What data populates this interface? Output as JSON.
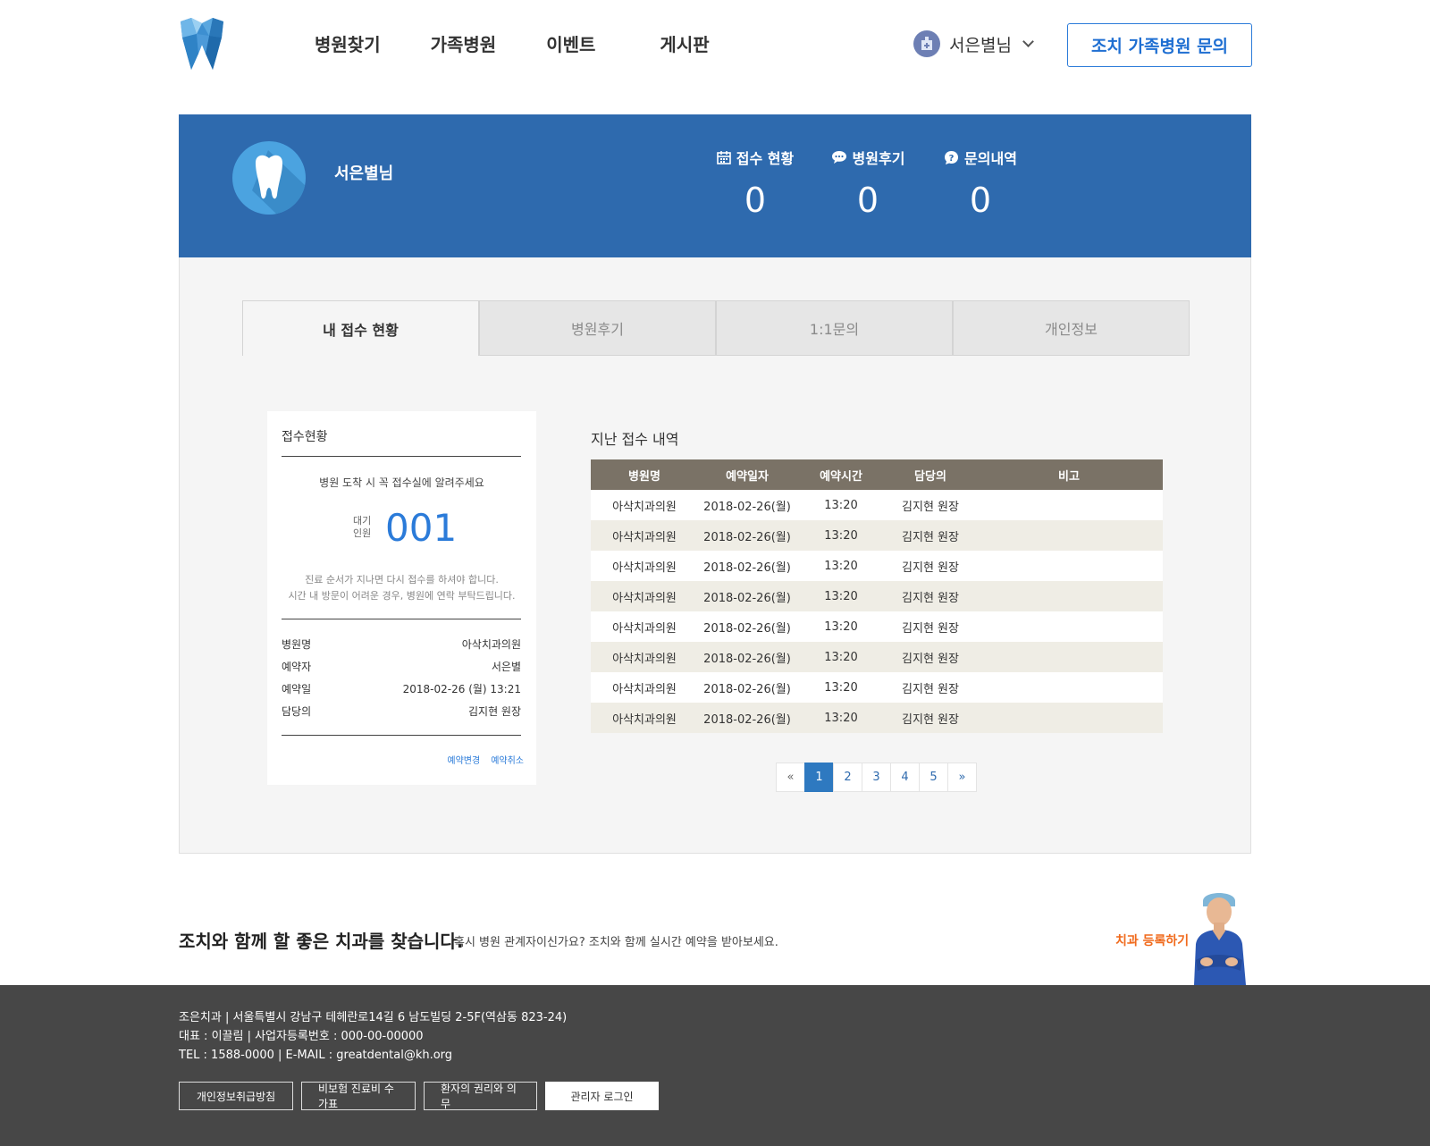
{
  "header": {
    "nav": [
      "병원찾기",
      "가족병원",
      "이벤트",
      "게시판"
    ],
    "user_name": "서은별님",
    "inquiry_button": "조치 가족병원 문의"
  },
  "profile": {
    "name": "서은별님",
    "stats": [
      {
        "icon": "calendar-icon",
        "label": "접수 현황",
        "value": "0"
      },
      {
        "icon": "chat-icon",
        "label": "병원후기",
        "value": "0"
      },
      {
        "icon": "question-icon",
        "label": "문의내역",
        "value": "0"
      }
    ]
  },
  "tabs": [
    "내 접수 현황",
    "병원후기",
    "1:1문의",
    "개인정보"
  ],
  "reception_card": {
    "title": "접수현황",
    "notice": "병원 도착 시 꼭 접수실에 알려주세요",
    "wait_label_1": "대기",
    "wait_label_2": "인원",
    "wait_number": "001",
    "note_1": "진료 순서가 지나면 다시 접수를 하셔야 합니다.",
    "note_2": "시간 내 방문이 어려운 경우, 병원에 연락 부탁드립니다.",
    "rows": [
      {
        "label": "병원명",
        "value": "아삭치과의원"
      },
      {
        "label": "예약자",
        "value": "서은별"
      },
      {
        "label": "예약일",
        "value": "2018-02-26 (월) 13:21"
      },
      {
        "label": "담당의",
        "value": "김지현 원장"
      }
    ],
    "change_link": "예약변경",
    "cancel_link": "예약취소"
  },
  "history": {
    "title": "지난 접수 내역",
    "columns": [
      "병원명",
      "예약일자",
      "예약시간",
      "담당의",
      "비고"
    ],
    "rows": [
      [
        "아삭치과의원",
        "2018-02-26(월)",
        "13:20",
        "김지현 원장",
        ""
      ],
      [
        "아삭치과의원",
        "2018-02-26(월)",
        "13:20",
        "김지현 원장",
        ""
      ],
      [
        "아삭치과의원",
        "2018-02-26(월)",
        "13:20",
        "김지현 원장",
        ""
      ],
      [
        "아삭치과의원",
        "2018-02-26(월)",
        "13:20",
        "김지현 원장",
        ""
      ],
      [
        "아삭치과의원",
        "2018-02-26(월)",
        "13:20",
        "김지현 원장",
        ""
      ],
      [
        "아삭치과의원",
        "2018-02-26(월)",
        "13:20",
        "김지현 원장",
        ""
      ],
      [
        "아삭치과의원",
        "2018-02-26(월)",
        "13:20",
        "김지현 원장",
        ""
      ],
      [
        "아삭치과의원",
        "2018-02-26(월)",
        "13:20",
        "김지현 원장",
        ""
      ]
    ],
    "pagination": {
      "prev": "«",
      "pages": [
        "1",
        "2",
        "3",
        "4",
        "5"
      ],
      "current": "1",
      "next": "»"
    }
  },
  "promo": {
    "title": "조치와 함께 할 좋은 치과를 찾습니다.",
    "subtitle": "혹시 병원 관계자이신가요? 조치와 함께 실시간 예약을 받아보세요.",
    "link": "치과 등록하기"
  },
  "footer": {
    "line1": "조은치과 | 서울특별시 강남구 테헤란로14길 6 남도빌딩 2-5F(역삼동 823-24)",
    "line2": "대표 : 이끌림 | 사업자등록번호 : 000-00-00000",
    "line3": "TEL : 1588-0000 | E-MAIL : greatdental@kh.org",
    "buttons": [
      "개인정보취급방침",
      "비보험 진료비 수가표",
      "환자의 권리와 의무",
      "관리자 로그인"
    ]
  },
  "colors": {
    "brand_blue": "#2e6aae",
    "accent_blue": "#2b7bd9",
    "table_header": "#7a7266",
    "promo_orange": "#f06a1c",
    "footer_bg": "#474747"
  }
}
